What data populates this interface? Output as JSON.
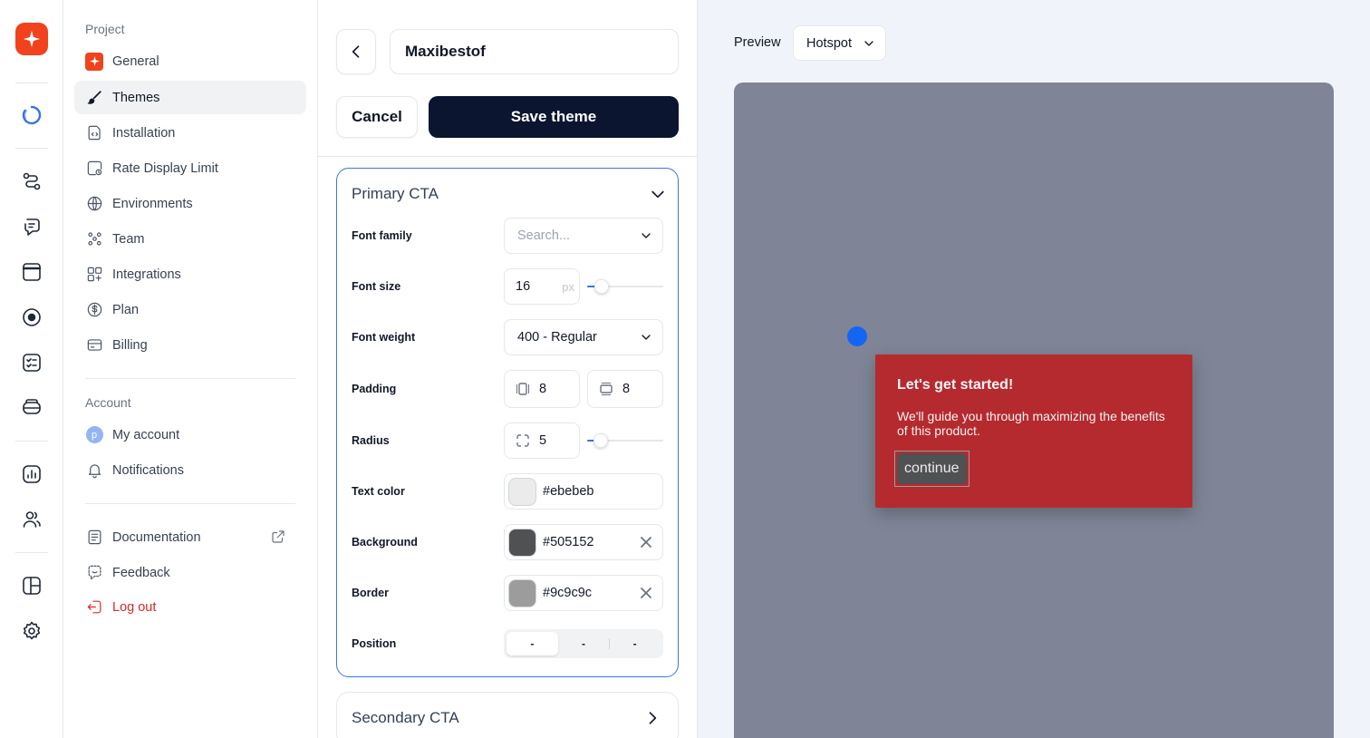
{
  "rail": {
    "icons": [
      "brand-logo-icon",
      "loader-icon",
      "flow-icon",
      "message-icon",
      "banner-icon",
      "hotspot-icon",
      "checklist-icon",
      "layers-icon",
      "analytics-icon",
      "users-icon",
      "layout-icon",
      "settings-icon"
    ],
    "brand_color": "#f0421c"
  },
  "nav": {
    "project_title": "Project",
    "project_items": [
      {
        "label": "General",
        "icon": "brand-square-icon"
      },
      {
        "label": "Themes",
        "icon": "brush-icon",
        "active": true
      },
      {
        "label": "Installation",
        "icon": "code-file-icon"
      },
      {
        "label": "Rate Display Limit",
        "icon": "rate-limit-icon"
      },
      {
        "label": "Environments",
        "icon": "globe-icon"
      },
      {
        "label": "Team",
        "icon": "team-icon"
      },
      {
        "label": "Integrations",
        "icon": "integrations-icon"
      },
      {
        "label": "Plan",
        "icon": "dollar-icon"
      },
      {
        "label": "Billing",
        "icon": "card-icon"
      }
    ],
    "account_title": "Account",
    "account_items": [
      {
        "label": "My account",
        "icon": "avatar-icon",
        "avatar_letter": "p"
      },
      {
        "label": "Notifications",
        "icon": "bell-icon"
      }
    ],
    "footer_items": [
      {
        "label": "Documentation",
        "icon": "doc-icon"
      },
      {
        "label": "Feedback",
        "icon": "feedback-icon"
      },
      {
        "label": "Log out",
        "icon": "logout-icon"
      }
    ]
  },
  "editor": {
    "theme_name": "Maxibestof",
    "cancel_label": "Cancel",
    "save_label": "Save theme",
    "primary_cta": {
      "title": "Primary CTA",
      "font_family": {
        "label": "Font family",
        "placeholder": "Search..."
      },
      "font_size": {
        "label": "Font size",
        "value": "16",
        "unit": "px",
        "slider_fraction": 0.12
      },
      "font_weight": {
        "label": "Font weight",
        "value": "400 - Regular"
      },
      "padding": {
        "label": "Padding",
        "vertical": "8",
        "horizontal": "8"
      },
      "radius": {
        "label": "Radius",
        "value": "5",
        "slider_fraction": 0.1
      },
      "text_color": {
        "label": "Text color",
        "value": "#ebebeb"
      },
      "background": {
        "label": "Background",
        "value": "#505152"
      },
      "border": {
        "label": "Border",
        "value": "#9c9c9c"
      },
      "position": {
        "label": "Position",
        "options": [
          "-",
          "-",
          "-"
        ],
        "selected": 0
      }
    },
    "secondary_cta": {
      "title": "Secondary CTA"
    }
  },
  "preview": {
    "label": "Preview",
    "mode": "Hotspot",
    "canvas_color": "#7f8597",
    "hotspot_color": "#1565f5",
    "tooltip": {
      "title": "Let's get started!",
      "body": "We'll guide you through maximizing the benefits of this product.",
      "button": "continue",
      "background": "#b52a2f"
    }
  }
}
